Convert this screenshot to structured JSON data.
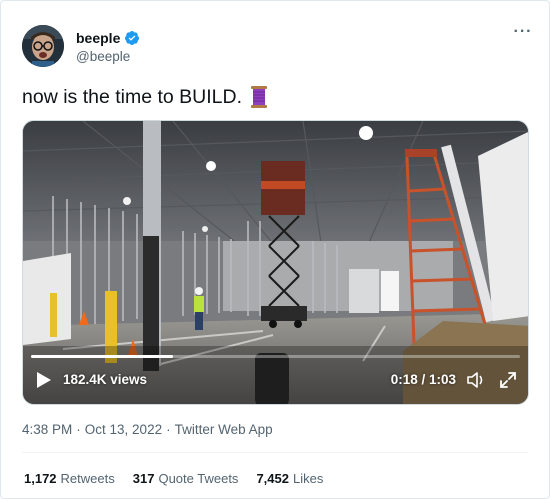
{
  "author": {
    "display_name": "beeple",
    "handle": "@beeple",
    "verified": true,
    "verified_color": "#1d9bf0"
  },
  "tweet": {
    "text": "now is the time to BUILD.",
    "emoji_icon": "thread-spool-icon"
  },
  "video": {
    "views": "182.4K views",
    "time": "0:18 / 1:03",
    "progress": 0.29
  },
  "meta": {
    "time": "4:38 PM",
    "separator1": "·",
    "date": "Oct 13, 2022",
    "separator2": "·",
    "source": "Twitter Web App"
  },
  "stats": {
    "retweets_count": "1,172",
    "retweets_label": "Retweets",
    "quotes_count": "317",
    "quotes_label": "Quote Tweets",
    "likes_count": "7,452",
    "likes_label": "Likes"
  },
  "icons": {
    "more": "more-icon",
    "play": "play-icon",
    "volume": "volume-icon",
    "fullscreen": "fullscreen-icon"
  }
}
